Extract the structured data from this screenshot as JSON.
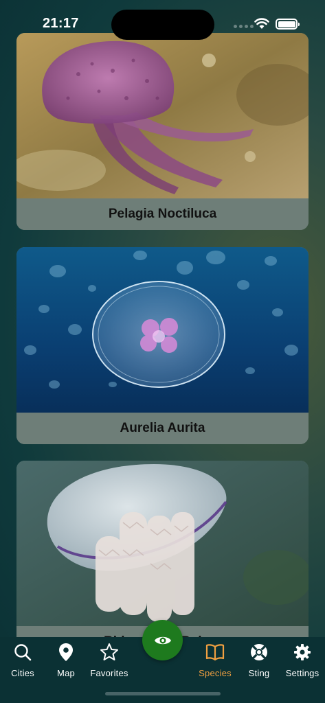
{
  "status_bar": {
    "time": "21:17"
  },
  "species": [
    {
      "name": "Pelagia Noctiluca"
    },
    {
      "name": "Aurelia Aurita"
    },
    {
      "name": "Rhizostoma Pulmo"
    }
  ],
  "tab_bar": {
    "tabs": [
      {
        "label": "Cities",
        "icon": "search-icon"
      },
      {
        "label": "Map",
        "icon": "map-pin-icon"
      },
      {
        "label": "Favorites",
        "icon": "star-icon"
      },
      {
        "label": "Species",
        "icon": "book-icon",
        "active": true
      },
      {
        "label": "Sting",
        "icon": "lifebuoy-icon"
      },
      {
        "label": "Settings",
        "icon": "gear-icon"
      }
    ],
    "center_button_icon": "eye-icon",
    "active_color": "#f1a041",
    "center_button_color": "#1e7a1e"
  }
}
